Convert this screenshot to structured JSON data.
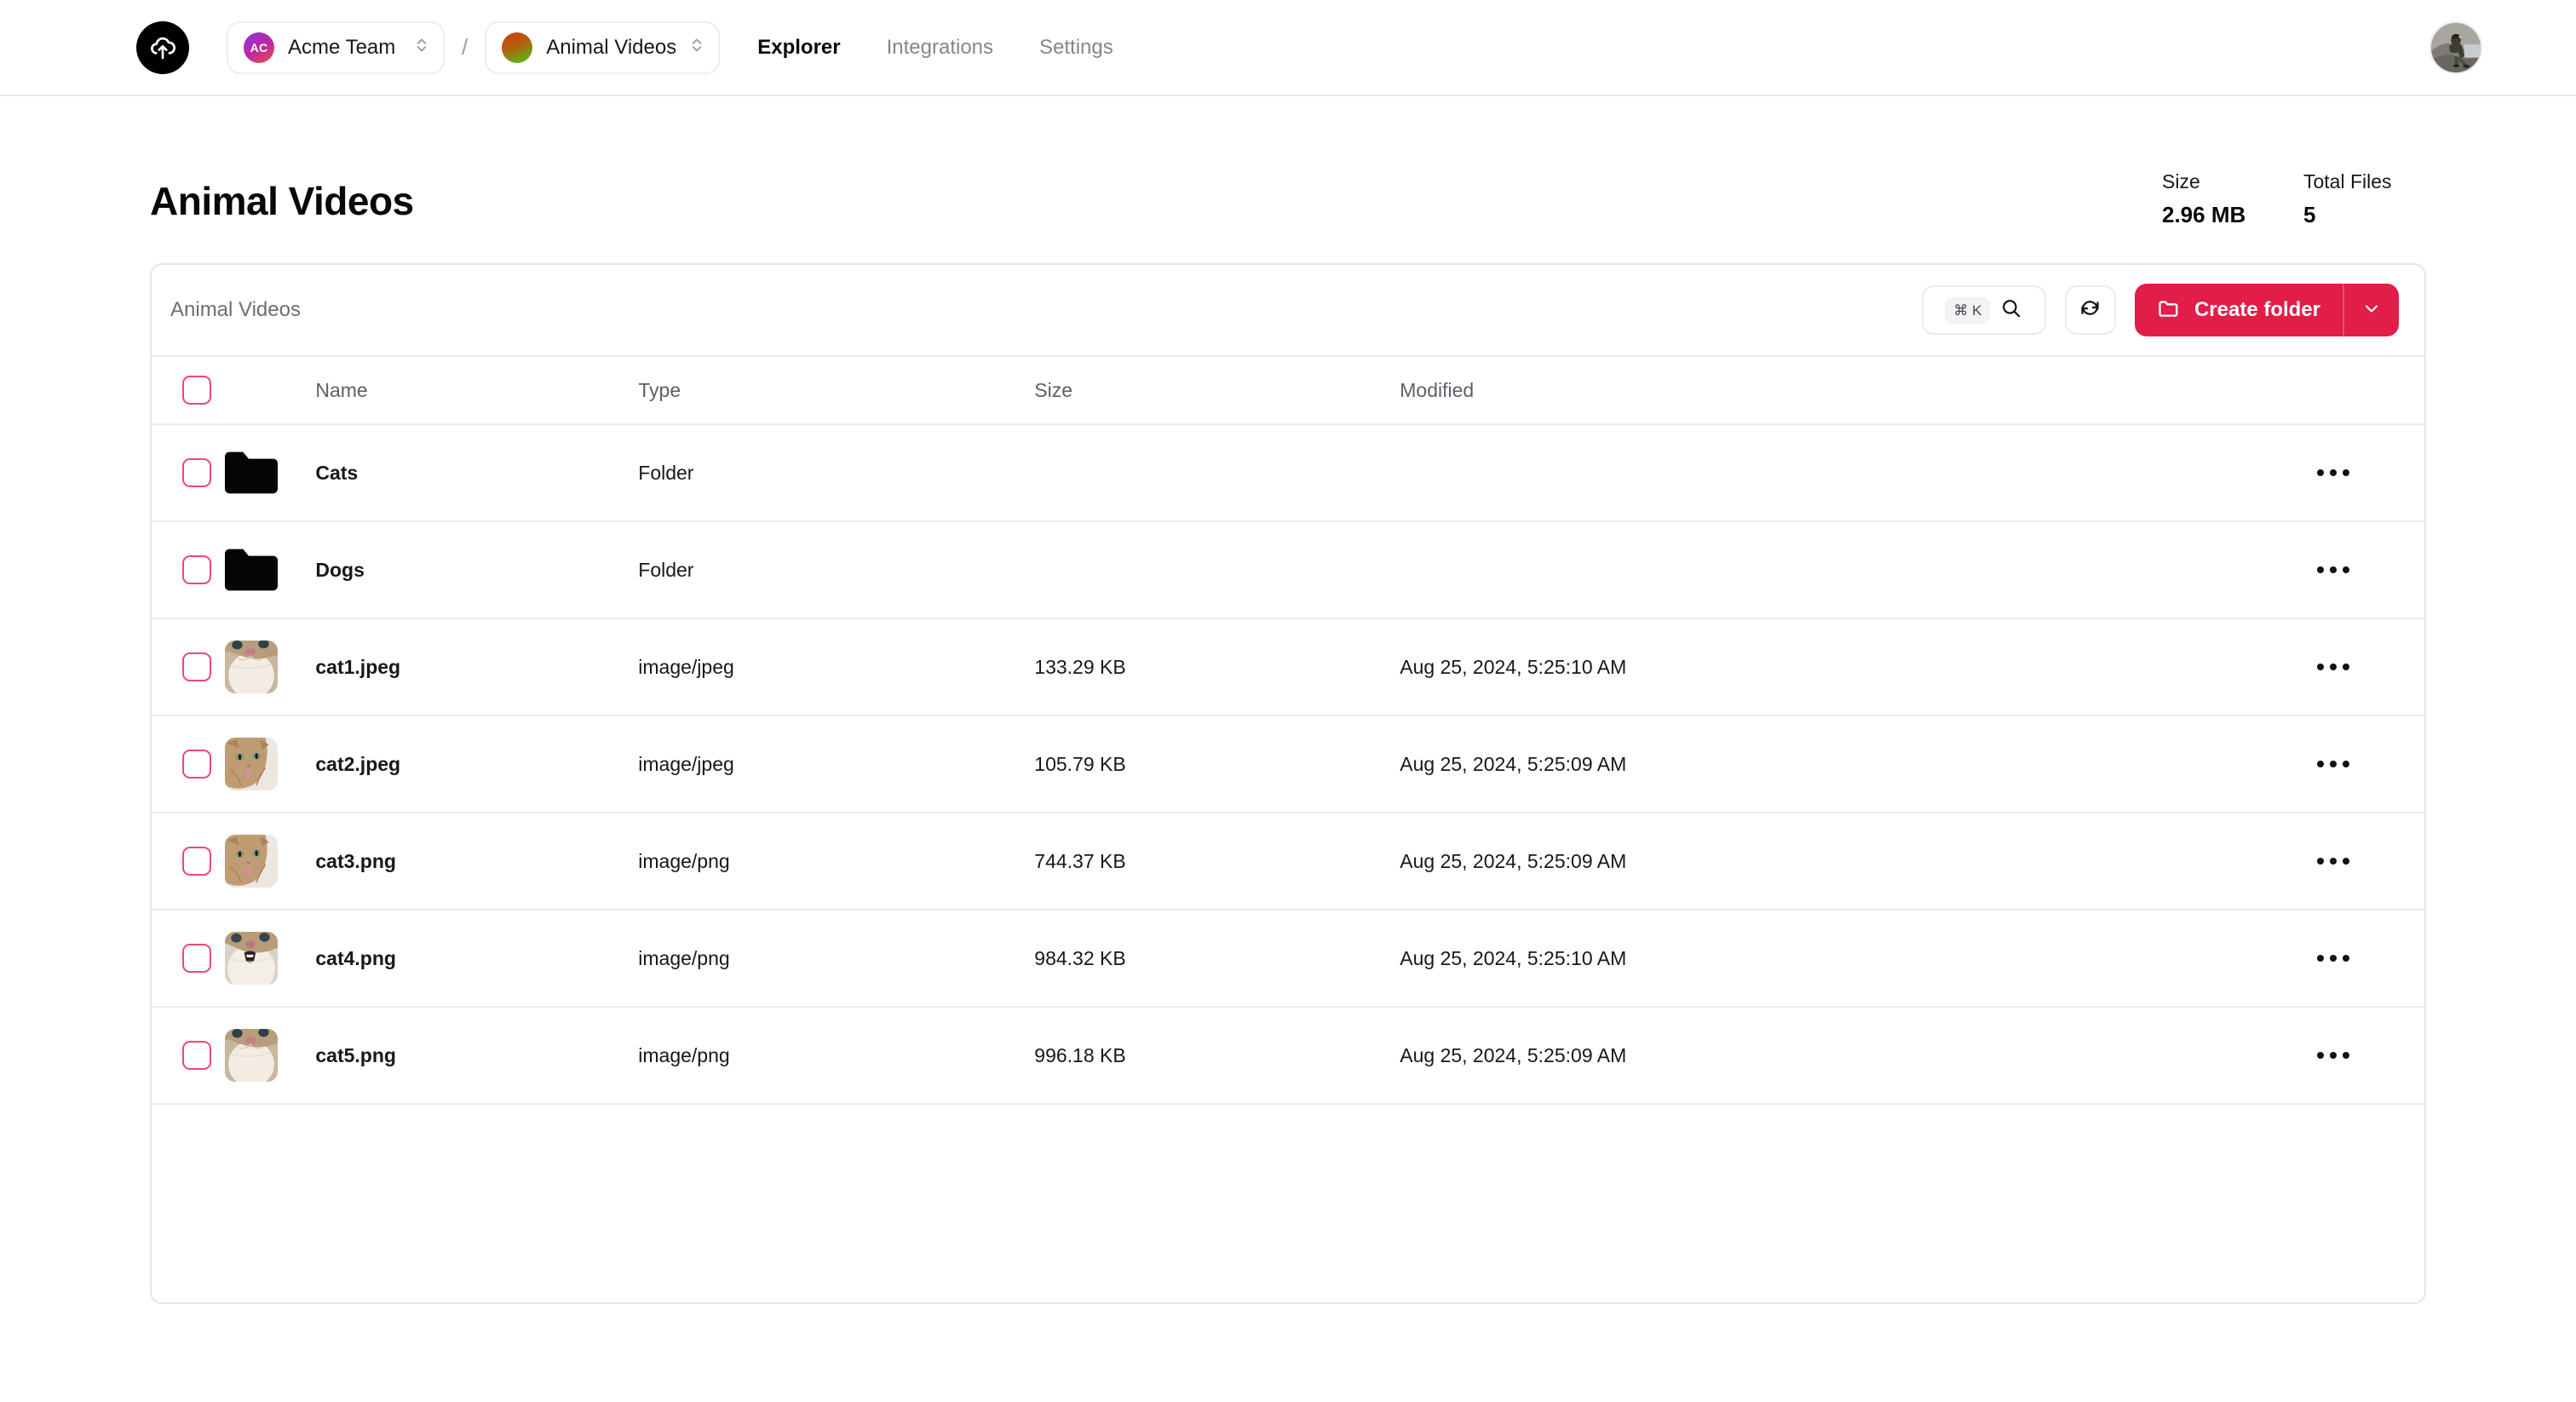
{
  "brand": {
    "logo_icon": "cloud-upload-icon",
    "accent_color": "#e11d48"
  },
  "topnav": {
    "team_selector": {
      "avatar_initials": "AC",
      "label": "Acme Team",
      "chevron_icon": "chevron-up-down-icon"
    },
    "separator": "/",
    "project_selector": {
      "label": "Animal Videos",
      "avatar_icon": "project-avatar",
      "chevron_icon": "chevron-up-down-icon"
    },
    "links": [
      {
        "label": "Explorer",
        "active": true
      },
      {
        "label": "Integrations",
        "active": false
      },
      {
        "label": "Settings",
        "active": false
      }
    ],
    "user_avatar": "user-avatar-photo"
  },
  "page": {
    "title": "Animal Videos",
    "stats": [
      {
        "label": "Size",
        "value": "2.96 MB"
      },
      {
        "label": "Total Files",
        "value": "5"
      }
    ]
  },
  "toolbar": {
    "breadcrumb": "Animal Videos",
    "search": {
      "kbd": "⌘ K",
      "icon": "search-icon"
    },
    "refresh": {
      "icon": "refresh-icon"
    },
    "create_folder": {
      "label": "Create folder",
      "icon": "folder-icon",
      "chevron_icon": "chevron-down-icon"
    }
  },
  "table": {
    "columns": [
      "",
      "",
      "Name",
      "Type",
      "Size",
      "Modified",
      ""
    ],
    "headers": {
      "name": "Name",
      "type": "Type",
      "size": "Size",
      "modified": "Modified"
    },
    "rows": [
      {
        "icon": "folder-icon",
        "name": "Cats",
        "type": "Folder",
        "size": "",
        "modified": "",
        "checked": false
      },
      {
        "icon": "folder-icon",
        "name": "Dogs",
        "type": "Folder",
        "size": "",
        "modified": "",
        "checked": false
      },
      {
        "icon": "thumbnail",
        "name": "cat1.jpeg",
        "type": "image/jpeg",
        "size": "133.29 KB",
        "modified": "Aug 25, 2024, 5:25:10 AM",
        "checked": false
      },
      {
        "icon": "thumbnail",
        "name": "cat2.jpeg",
        "type": "image/jpeg",
        "size": "105.79 KB",
        "modified": "Aug 25, 2024, 5:25:09 AM",
        "checked": false
      },
      {
        "icon": "thumbnail",
        "name": "cat3.png",
        "type": "image/png",
        "size": "744.37 KB",
        "modified": "Aug 25, 2024, 5:25:09 AM",
        "checked": false
      },
      {
        "icon": "thumbnail",
        "name": "cat4.png",
        "type": "image/png",
        "size": "984.32 KB",
        "modified": "Aug 25, 2024, 5:25:10 AM",
        "checked": false
      },
      {
        "icon": "thumbnail",
        "name": "cat5.png",
        "type": "image/png",
        "size": "996.18 KB",
        "modified": "Aug 25, 2024, 5:25:09 AM",
        "checked": false
      }
    ],
    "row_menu_icon": "more-horizontal-icon"
  }
}
